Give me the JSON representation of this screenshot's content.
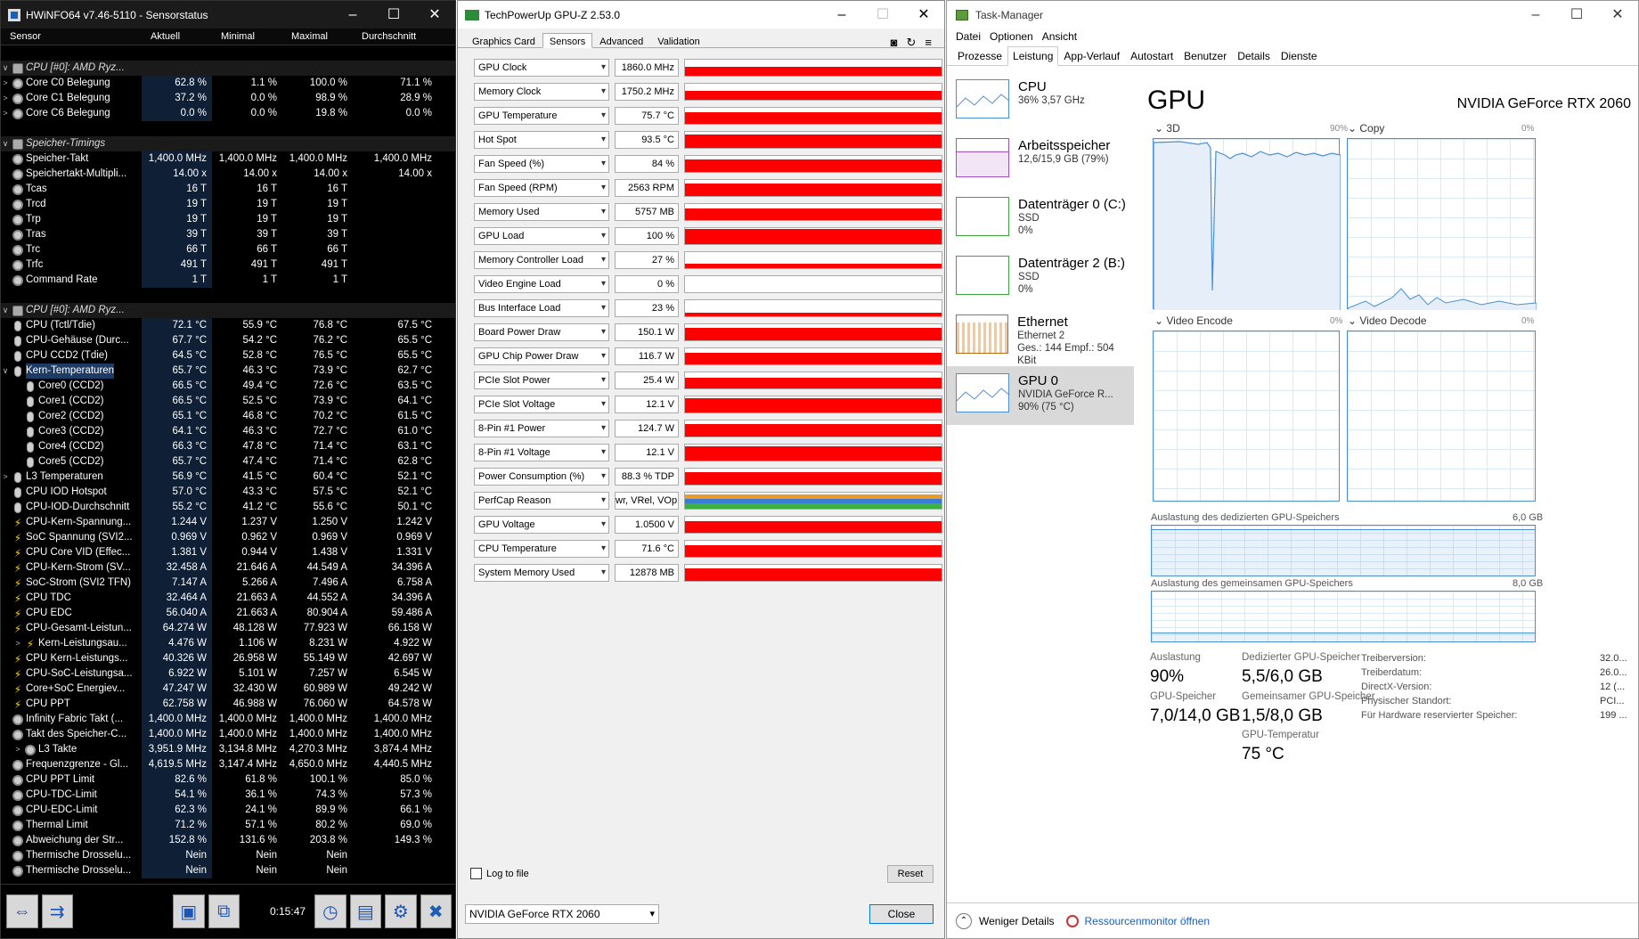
{
  "hwinfo": {
    "title": "HWiNFO64 v7.46-5110 - Sensorstatus",
    "columns": [
      "Sensor",
      "Aktuell",
      "Minimal",
      "Maximal",
      "Durchschnitt"
    ],
    "rows": [
      {
        "exp": "",
        "ic": "",
        "name": "",
        "v": [
          "",
          "",
          "",
          ""
        ]
      },
      {
        "exp": "∨",
        "ic": "cpu",
        "name": "CPU [#0]: AMD Ryz...",
        "v": [
          "",
          "",
          "",
          ""
        ],
        "grp": true
      },
      {
        "exp": ">",
        "ic": "circle",
        "name": "Core C0 Belegung",
        "v": [
          "62.8 %",
          "1.1 %",
          "100.0 %",
          "71.1 %"
        ]
      },
      {
        "exp": ">",
        "ic": "circle",
        "name": "Core C1 Belegung",
        "v": [
          "37.2 %",
          "0.0 %",
          "98.9 %",
          "28.9 %"
        ]
      },
      {
        "exp": ">",
        "ic": "circle",
        "name": "Core C6 Belegung",
        "v": [
          "0.0 %",
          "0.0 %",
          "19.8 %",
          "0.0 %"
        ]
      },
      {
        "exp": "",
        "ic": "",
        "name": "",
        "v": [
          "",
          "",
          "",
          ""
        ]
      },
      {
        "exp": "∨",
        "ic": "cpu",
        "name": "Speicher-Timings",
        "v": [
          "",
          "",
          "",
          ""
        ],
        "grp": true
      },
      {
        "exp": "",
        "ic": "circle",
        "name": "Speicher-Takt",
        "v": [
          "1,400.0 MHz",
          "1,400.0 MHz",
          "1,400.0 MHz",
          "1,400.0 MHz"
        ]
      },
      {
        "exp": "",
        "ic": "circle",
        "name": "Speichertakt-Multipli...",
        "v": [
          "14.00 x",
          "14.00 x",
          "14.00 x",
          "14.00 x"
        ]
      },
      {
        "exp": "",
        "ic": "circle",
        "name": "Tcas",
        "v": [
          "16 T",
          "16 T",
          "16 T",
          ""
        ]
      },
      {
        "exp": "",
        "ic": "circle",
        "name": "Trcd",
        "v": [
          "19 T",
          "19 T",
          "19 T",
          ""
        ]
      },
      {
        "exp": "",
        "ic": "circle",
        "name": "Trp",
        "v": [
          "19 T",
          "19 T",
          "19 T",
          ""
        ]
      },
      {
        "exp": "",
        "ic": "circle",
        "name": "Tras",
        "v": [
          "39 T",
          "39 T",
          "39 T",
          ""
        ]
      },
      {
        "exp": "",
        "ic": "circle",
        "name": "Trc",
        "v": [
          "66 T",
          "66 T",
          "66 T",
          ""
        ]
      },
      {
        "exp": "",
        "ic": "circle",
        "name": "Trfc",
        "v": [
          "491 T",
          "491 T",
          "491 T",
          ""
        ]
      },
      {
        "exp": "",
        "ic": "circle",
        "name": "Command Rate",
        "v": [
          "1 T",
          "1 T",
          "1 T",
          ""
        ]
      },
      {
        "exp": "",
        "ic": "",
        "name": "",
        "v": [
          "",
          "",
          "",
          ""
        ]
      },
      {
        "exp": "∨",
        "ic": "cpu",
        "name": "CPU [#0]: AMD Ryz...",
        "v": [
          "",
          "",
          "",
          ""
        ],
        "grp": true
      },
      {
        "exp": "",
        "ic": "therm",
        "name": "CPU (Tctl/Tdie)",
        "v": [
          "72.1 °C",
          "55.9 °C",
          "76.8 °C",
          "67.5 °C"
        ]
      },
      {
        "exp": "",
        "ic": "therm",
        "name": "CPU-Gehäuse (Durc...",
        "v": [
          "67.7 °C",
          "54.2 °C",
          "76.2 °C",
          "65.5 °C"
        ]
      },
      {
        "exp": "",
        "ic": "therm",
        "name": "CPU CCD2 (Tdie)",
        "v": [
          "64.5 °C",
          "52.8 °C",
          "76.5 °C",
          "65.5 °C"
        ]
      },
      {
        "exp": "∨",
        "ic": "therm",
        "name": "Kern-Temperaturen",
        "v": [
          "65.7 °C",
          "46.3 °C",
          "73.9 °C",
          "62.7 °C"
        ],
        "sel": true
      },
      {
        "exp": "",
        "ic": "therm",
        "name": "Core0 (CCD2)",
        "v": [
          "66.5 °C",
          "49.4 °C",
          "72.6 °C",
          "63.5 °C"
        ],
        "ind": true
      },
      {
        "exp": "",
        "ic": "therm",
        "name": "Core1 (CCD2)",
        "v": [
          "66.5 °C",
          "52.5 °C",
          "73.9 °C",
          "64.1 °C"
        ],
        "ind": true
      },
      {
        "exp": "",
        "ic": "therm",
        "name": "Core2 (CCD2)",
        "v": [
          "65.1 °C",
          "46.8 °C",
          "70.2 °C",
          "61.5 °C"
        ],
        "ind": true
      },
      {
        "exp": "",
        "ic": "therm",
        "name": "Core3 (CCD2)",
        "v": [
          "64.1 °C",
          "46.3 °C",
          "72.7 °C",
          "61.0 °C"
        ],
        "ind": true
      },
      {
        "exp": "",
        "ic": "therm",
        "name": "Core4 (CCD2)",
        "v": [
          "66.3 °C",
          "47.8 °C",
          "71.4 °C",
          "63.1 °C"
        ],
        "ind": true
      },
      {
        "exp": "",
        "ic": "therm",
        "name": "Core5 (CCD2)",
        "v": [
          "65.7 °C",
          "47.4 °C",
          "71.4 °C",
          "62.8 °C"
        ],
        "ind": true
      },
      {
        "exp": ">",
        "ic": "therm",
        "name": "L3 Temperaturen",
        "v": [
          "56.9 °C",
          "41.5 °C",
          "60.4 °C",
          "52.1 °C"
        ]
      },
      {
        "exp": "",
        "ic": "therm",
        "name": "CPU IOD Hotspot",
        "v": [
          "57.0 °C",
          "43.3 °C",
          "57.5 °C",
          "52.1 °C"
        ]
      },
      {
        "exp": "",
        "ic": "therm",
        "name": "CPU-IOD-Durchschnitt",
        "v": [
          "55.2 °C",
          "41.2 °C",
          "55.6 °C",
          "50.1 °C"
        ]
      },
      {
        "exp": "",
        "ic": "bolt",
        "name": "CPU-Kern-Spannung...",
        "v": [
          "1.244 V",
          "1.237 V",
          "1.250 V",
          "1.242 V"
        ]
      },
      {
        "exp": "",
        "ic": "bolt",
        "name": "SoC Spannung (SVI2...",
        "v": [
          "0.969 V",
          "0.962 V",
          "0.969 V",
          "0.969 V"
        ]
      },
      {
        "exp": "",
        "ic": "bolt",
        "name": "CPU Core VID (Effec...",
        "v": [
          "1.381 V",
          "0.944 V",
          "1.438 V",
          "1.331 V"
        ]
      },
      {
        "exp": "",
        "ic": "bolt",
        "name": "CPU-Kern-Strom (SV...",
        "v": [
          "32.458 A",
          "21.646 A",
          "44.549 A",
          "34.396 A"
        ]
      },
      {
        "exp": "",
        "ic": "bolt",
        "name": "SoC-Strom (SVI2 TFN)",
        "v": [
          "7.147 A",
          "5.266 A",
          "7.496 A",
          "6.758 A"
        ]
      },
      {
        "exp": "",
        "ic": "bolt",
        "name": "CPU TDC",
        "v": [
          "32.464 A",
          "21.663 A",
          "44.552 A",
          "34.396 A"
        ]
      },
      {
        "exp": "",
        "ic": "bolt",
        "name": "CPU EDC",
        "v": [
          "56.040 A",
          "21.663 A",
          "80.904 A",
          "59.486 A"
        ]
      },
      {
        "exp": "",
        "ic": "bolt",
        "name": "CPU-Gesamt-Leistun...",
        "v": [
          "64.274 W",
          "48.128 W",
          "77.923 W",
          "66.158 W"
        ]
      },
      {
        "exp": ">",
        "ic": "bolt",
        "name": "Kern-Leistungsau...",
        "v": [
          "4.476 W",
          "1.106 W",
          "8.231 W",
          "4.922 W"
        ],
        "ind": true
      },
      {
        "exp": "",
        "ic": "bolt",
        "name": "CPU Kern-Leistungs...",
        "v": [
          "40.326 W",
          "26.958 W",
          "55.149 W",
          "42.697 W"
        ]
      },
      {
        "exp": "",
        "ic": "bolt",
        "name": "CPU-SoC-Leistungsa...",
        "v": [
          "6.922 W",
          "5.101 W",
          "7.257 W",
          "6.545 W"
        ]
      },
      {
        "exp": "",
        "ic": "bolt",
        "name": "Core+SoC Energiev...",
        "v": [
          "47.247 W",
          "32.430 W",
          "60.989 W",
          "49.242 W"
        ]
      },
      {
        "exp": "",
        "ic": "bolt",
        "name": "CPU PPT",
        "v": [
          "62.758 W",
          "46.988 W",
          "76.060 W",
          "64.578 W"
        ]
      },
      {
        "exp": "",
        "ic": "circle",
        "name": "Infinity Fabric Takt (...",
        "v": [
          "1,400.0 MHz",
          "1,400.0 MHz",
          "1,400.0 MHz",
          "1,400.0 MHz"
        ]
      },
      {
        "exp": "",
        "ic": "circle",
        "name": "Takt des Speicher-C...",
        "v": [
          "1,400.0 MHz",
          "1,400.0 MHz",
          "1,400.0 MHz",
          "1,400.0 MHz"
        ]
      },
      {
        "exp": ">",
        "ic": "circle",
        "name": "L3 Takte",
        "v": [
          "3,951.9 MHz",
          "3,134.8 MHz",
          "4,270.3 MHz",
          "3,874.4 MHz"
        ],
        "ind": true
      },
      {
        "exp": "",
        "ic": "circle",
        "name": "Frequenzgrenze - Gl...",
        "v": [
          "4,619.5 MHz",
          "3,147.4 MHz",
          "4,650.0 MHz",
          "4,440.5 MHz"
        ]
      },
      {
        "exp": "",
        "ic": "circle",
        "name": "CPU PPT Limit",
        "v": [
          "82.6 %",
          "61.8 %",
          "100.1 %",
          "85.0 %"
        ]
      },
      {
        "exp": "",
        "ic": "circle",
        "name": "CPU-TDC-Limit",
        "v": [
          "54.1 %",
          "36.1 %",
          "74.3 %",
          "57.3 %"
        ]
      },
      {
        "exp": "",
        "ic": "circle",
        "name": "CPU-EDC-Limit",
        "v": [
          "62.3 %",
          "24.1 %",
          "89.9 %",
          "66.1 %"
        ]
      },
      {
        "exp": "",
        "ic": "circle",
        "name": "Thermal Limit",
        "v": [
          "71.2 %",
          "57.1 %",
          "80.2 %",
          "69.0 %"
        ]
      },
      {
        "exp": "",
        "ic": "circle",
        "name": "Abweichung der Str...",
        "v": [
          "152.8 %",
          "131.6 %",
          "203.8 %",
          "149.3 %"
        ]
      },
      {
        "exp": "",
        "ic": "circle",
        "name": "Thermische Drosselu...",
        "v": [
          "Nein",
          "Nein",
          "Nein",
          ""
        ]
      },
      {
        "exp": "",
        "ic": "circle",
        "name": "Thermische Drosselu...",
        "v": [
          "Nein",
          "Nein",
          "Nein",
          ""
        ]
      }
    ],
    "time": "0:15:47"
  },
  "gpuz": {
    "title": "TechPowerUp GPU-Z 2.53.0",
    "tabs": [
      "Graphics Card",
      "Sensors",
      "Advanced",
      "Validation"
    ],
    "sensors": [
      {
        "label": "GPU Clock",
        "value": "1860.0 MHz",
        "fill": 0.55
      },
      {
        "label": "Memory Clock",
        "value": "1750.2 MHz",
        "fill": 0.55
      },
      {
        "label": "GPU Temperature",
        "value": "75.7 °C",
        "fill": 0.7
      },
      {
        "label": "Hot Spot",
        "value": "93.5 °C",
        "fill": 0.85
      },
      {
        "label": "Fan Speed (%)",
        "value": "84 %",
        "fill": 0.8
      },
      {
        "label": "Fan Speed (RPM)",
        "value": "2563 RPM",
        "fill": 0.8
      },
      {
        "label": "Memory Used",
        "value": "5757 MB",
        "fill": 0.7
      },
      {
        "label": "GPU Load",
        "value": "100 %",
        "fill": 0.95
      },
      {
        "label": "Memory Controller Load",
        "value": "27 %",
        "fill": 0.3
      },
      {
        "label": "Video Engine Load",
        "value": "0 %",
        "fill": 0
      },
      {
        "label": "Bus Interface Load",
        "value": "23 %",
        "fill": 0.25
      },
      {
        "label": "Board Power Draw",
        "value": "150.1 W",
        "fill": 0.8
      },
      {
        "label": "GPU Chip Power Draw",
        "value": "116.7 W",
        "fill": 0.75
      },
      {
        "label": "PCIe Slot Power",
        "value": "25.4 W",
        "fill": 0.65
      },
      {
        "label": "PCIe Slot Voltage",
        "value": "12.1 V",
        "fill": 0.9
      },
      {
        "label": "8-Pin #1 Power",
        "value": "124.7 W",
        "fill": 0.8
      },
      {
        "label": "8-Pin #1 Voltage",
        "value": "12.1 V",
        "fill": 0.9
      },
      {
        "label": "Power Consumption (%)",
        "value": "88.3 % TDP",
        "fill": 0.8
      },
      {
        "label": "PerfCap Reason",
        "value": "wr, VRel, VOp",
        "fill": 0,
        "perfcap": true
      },
      {
        "label": "GPU Voltage",
        "value": "1.0500 V",
        "fill": 0.75
      },
      {
        "label": "CPU Temperature",
        "value": "71.6 °C",
        "fill": 0.7
      },
      {
        "label": "System Memory Used",
        "value": "12878 MB",
        "fill": 0.8
      }
    ],
    "log_label": "Log to file",
    "reset_label": "Reset",
    "gpu_select": "NVIDIA GeForce RTX 2060",
    "close_label": "Close"
  },
  "taskmgr": {
    "title": "Task-Manager",
    "menu": [
      "Datei",
      "Optionen",
      "Ansicht"
    ],
    "tabs": [
      "Prozesse",
      "Leistung",
      "App-Verlauf",
      "Autostart",
      "Benutzer",
      "Details",
      "Dienste"
    ],
    "side": [
      {
        "h": "CPU",
        "s1": "36% 3,57 GHz",
        "s2": "",
        "s3": ""
      },
      {
        "h": "Arbeitsspeicher",
        "s1": "12,6/15,9 GB (79%)",
        "s2": "",
        "s3": ""
      },
      {
        "h": "Datenträger 0 (C:)",
        "s1": "SSD",
        "s2": "0%",
        "s3": ""
      },
      {
        "h": "Datenträger 2 (B:)",
        "s1": "SSD",
        "s2": "0%",
        "s3": ""
      },
      {
        "h": "Ethernet",
        "s1": "Ethernet 2",
        "s2": "Ges.: 144 Empf.: 504 KBit",
        "s3": ""
      },
      {
        "h": "GPU 0",
        "s1": "NVIDIA GeForce R...",
        "s2": "90% (75 °C)",
        "s3": ""
      }
    ],
    "gpu_title": "GPU",
    "gpu_name": "NVIDIA GeForce RTX 2060",
    "graphs": [
      {
        "label": "3D",
        "pct": "90%"
      },
      {
        "label": "Copy",
        "pct": "0%"
      },
      {
        "label": "Video Encode",
        "pct": "0%"
      },
      {
        "label": "Video Decode",
        "pct": "0%"
      }
    ],
    "ded_label": "Auslastung des dedizierten GPU-Speichers",
    "ded_max": "6,0 GB",
    "shared_label": "Auslastung des gemeinsamen GPU-Speichers",
    "shared_max": "8,0 GB",
    "stats": {
      "util_k": "Auslastung",
      "util_v": "90%",
      "ded_k": "Dedizierter GPU-Speicher",
      "ded_v": "5,5/6,0 GB",
      "gpumem_k": "GPU-Speicher",
      "gpumem_v": "7,0/14,0 GB",
      "shared_k": "Gemeinsamer GPU-Speicher",
      "shared_v": "1,5/8,0 GB",
      "temp_k": "GPU-Temperatur",
      "temp_v": "75 °C"
    },
    "info": [
      {
        "k": "Treiberversion:",
        "v": "32.0..."
      },
      {
        "k": "Treiberdatum:",
        "v": "26.0..."
      },
      {
        "k": "DirectX-Version:",
        "v": "12 (..."
      },
      {
        "k": "Physischer Standort:",
        "v": "PCI..."
      },
      {
        "k": "Für Hardware reservierter Speicher:",
        "v": "199 ..."
      }
    ],
    "fewer": "Weniger Details",
    "resmon": "Ressourcenmonitor öffnen"
  }
}
